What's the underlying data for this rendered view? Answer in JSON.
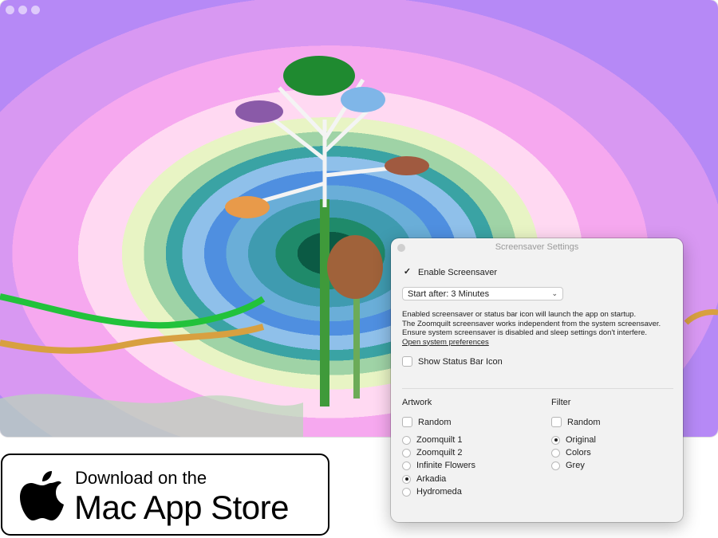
{
  "settings": {
    "title": "Screensaver Settings",
    "enable_screensaver": {
      "label": "Enable Screensaver",
      "checked": true
    },
    "start_after": {
      "value": "Start after: 3 Minutes"
    },
    "info_lines": [
      "Enabled screensaver or status bar icon will launch the app on startup.",
      "The Zoomquilt screensaver works independent from the system screensaver.",
      "Ensure system screensaver is disabled and sleep settings don't interfere."
    ],
    "open_prefs_link": "Open system preferences",
    "show_status_bar": {
      "label": "Show Status Bar Icon",
      "checked": false
    },
    "artwork": {
      "label": "Artwork",
      "random_label": "Random",
      "options": [
        "Zoomquilt 1",
        "Zoomquilt 2",
        "Infinite Flowers",
        "Arkadia",
        "Hydromeda"
      ],
      "selected": "Arkadia"
    },
    "filter": {
      "label": "Filter",
      "random_label": "Random",
      "options": [
        "Original",
        "Colors",
        "Grey"
      ],
      "selected": "Original"
    }
  },
  "badge": {
    "line1": "Download on the",
    "line2": "Mac App Store",
    "icon": "apple-logo-icon"
  },
  "colors": {
    "accent": "#222222",
    "panel": "#f2f2f2"
  }
}
